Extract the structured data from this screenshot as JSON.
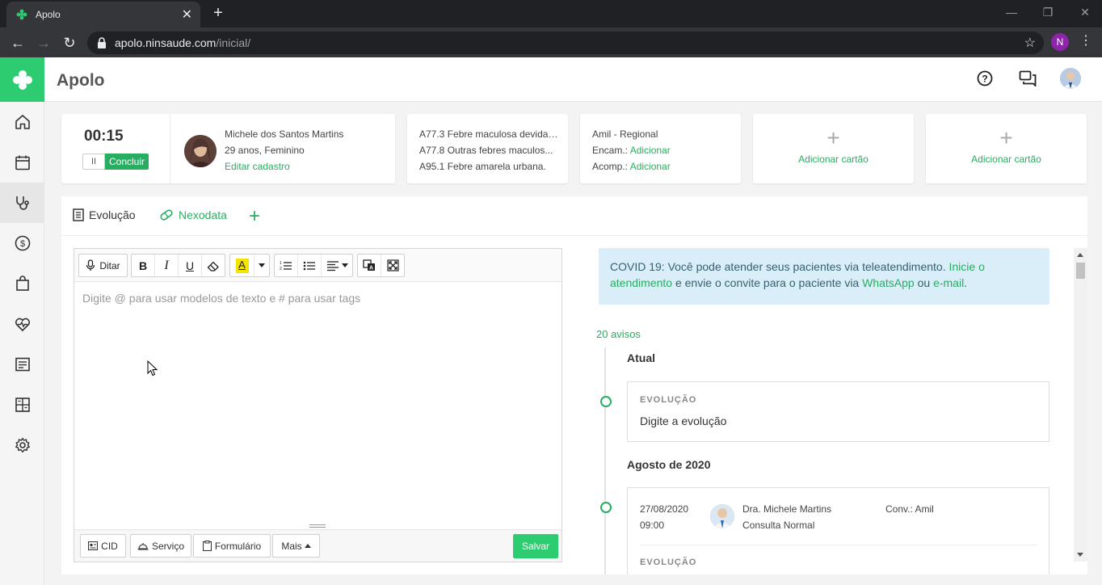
{
  "browser": {
    "tab_title": "Apolo",
    "url_host": "apolo.ninsaude.com",
    "url_path": "/inicial/",
    "profile_initial": "N"
  },
  "app": {
    "title": "Apolo",
    "brand_color": "#2ecc71"
  },
  "sidebar": {
    "items": [
      {
        "icon": "home-icon"
      },
      {
        "icon": "calendar-icon"
      },
      {
        "icon": "stethoscope-icon",
        "active": true
      },
      {
        "icon": "dollar-icon"
      },
      {
        "icon": "shopping-bag-icon"
      },
      {
        "icon": "heartbeat-icon"
      },
      {
        "icon": "list-icon"
      },
      {
        "icon": "dashboard-icon"
      },
      {
        "icon": "gear-icon"
      }
    ]
  },
  "timer_card": {
    "time": "00:15",
    "pause_label": "II",
    "finish_label": "Concluir"
  },
  "patient_card": {
    "name": "Michele dos Santos Martins",
    "details": "29 anos, Feminino",
    "edit_link": "Editar cadastro"
  },
  "cid_card": {
    "lines": [
      "A77.3 Febre maculosa devida ...",
      "A77.8 Outras febres maculos...",
      "A95.1 Febre amarela urbana."
    ]
  },
  "insurance_card": {
    "plan": "Amil - Regional",
    "referral_label": "Encam.:",
    "referral_link": "Adicionar",
    "companion_label": "Acomp.:",
    "companion_link": "Adicionar"
  },
  "add_cards": [
    {
      "label": "Adicionar cartão"
    },
    {
      "label": "Adicionar cartão"
    }
  ],
  "tabs": {
    "evolucao": "Evolução",
    "nexodata": "Nexodata"
  },
  "editor": {
    "dictate_label": "Ditar",
    "placeholder": "Digite @ para usar modelos de texto e # para usar tags",
    "footer": {
      "cid": "CID",
      "service": "Serviço",
      "form": "Formulário",
      "more": "Mais",
      "save": "Salvar"
    }
  },
  "covid_banner": {
    "text_1": "COVID 19: Você pode atender seus pacientes via teleatendimento. ",
    "link_1": "Inicie o atendimento",
    "text_2": " e envie o convite para o paciente via ",
    "link_2": "WhatsApp",
    "text_3": " ou ",
    "link_3": "e-mail",
    "text_4": "."
  },
  "timeline": {
    "avisos": "20 avisos",
    "section_current": "Atual",
    "current_card": {
      "caption": "EVOLUÇÃO",
      "text": "Digite a evolução"
    },
    "section_month": "Agosto de 2020",
    "entry": {
      "date": "27/08/2020",
      "time": "09:00",
      "doctor": "Dra. Michele Martins",
      "type": "Consulta Normal",
      "insurance": "Conv.: Amil",
      "caption": "EVOLUÇÃO"
    }
  }
}
